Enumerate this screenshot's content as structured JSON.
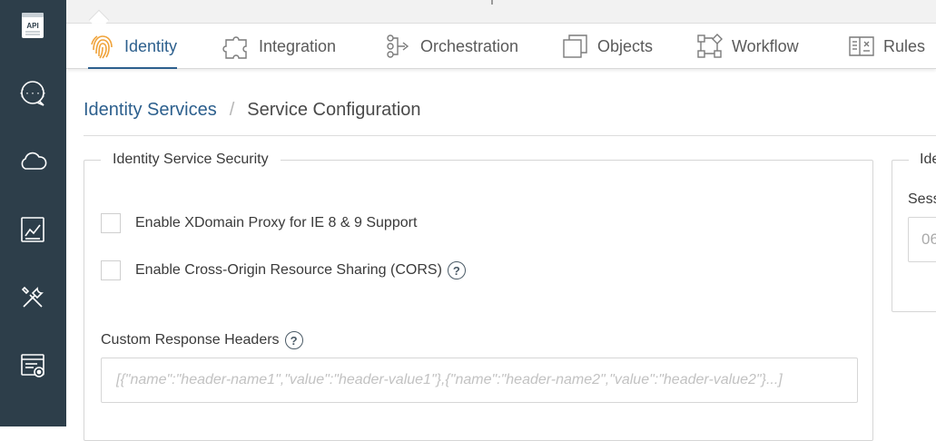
{
  "sidebar": {
    "items": [
      {
        "name": "api-icon",
        "label": "API"
      },
      {
        "name": "chat-icon"
      },
      {
        "name": "cloud-icon"
      },
      {
        "name": "analytics-icon"
      },
      {
        "name": "tools-icon"
      },
      {
        "name": "settings-card-icon"
      }
    ]
  },
  "tabs": [
    {
      "label": "Identity",
      "icon": "fingerprint-icon",
      "active": true
    },
    {
      "label": "Integration",
      "icon": "puzzle-icon"
    },
    {
      "label": "Orchestration",
      "icon": "orchestration-icon"
    },
    {
      "label": "Objects",
      "icon": "objects-icon"
    },
    {
      "label": "Workflow",
      "icon": "workflow-icon"
    },
    {
      "label": "Rules",
      "icon": "rules-icon"
    }
  ],
  "breadcrumb": {
    "parent": "Identity Services",
    "separator": "/",
    "current": "Service Configuration"
  },
  "security_panel": {
    "legend": "Identity Service Security",
    "xdomain_label": "Enable XDomain Proxy for IE 8 & 9 Support",
    "cors_label": "Enable Cross-Origin Resource Sharing (CORS)",
    "help_glyph": "?",
    "headers_label": "Custom Response Headers",
    "headers_placeholder": "[{\"name\":\"header-name1\",\"value\":\"header-value1\"},{\"name\":\"header-name2\",\"value\":\"header-value2\"}...]"
  },
  "side_panel": {
    "legend": "Ide",
    "label": "Sess",
    "value": "06"
  },
  "colors": {
    "sidebar_bg": "#2d3e4a",
    "accent": "#2c5f8d",
    "fingerprint": "#f0a33a"
  }
}
